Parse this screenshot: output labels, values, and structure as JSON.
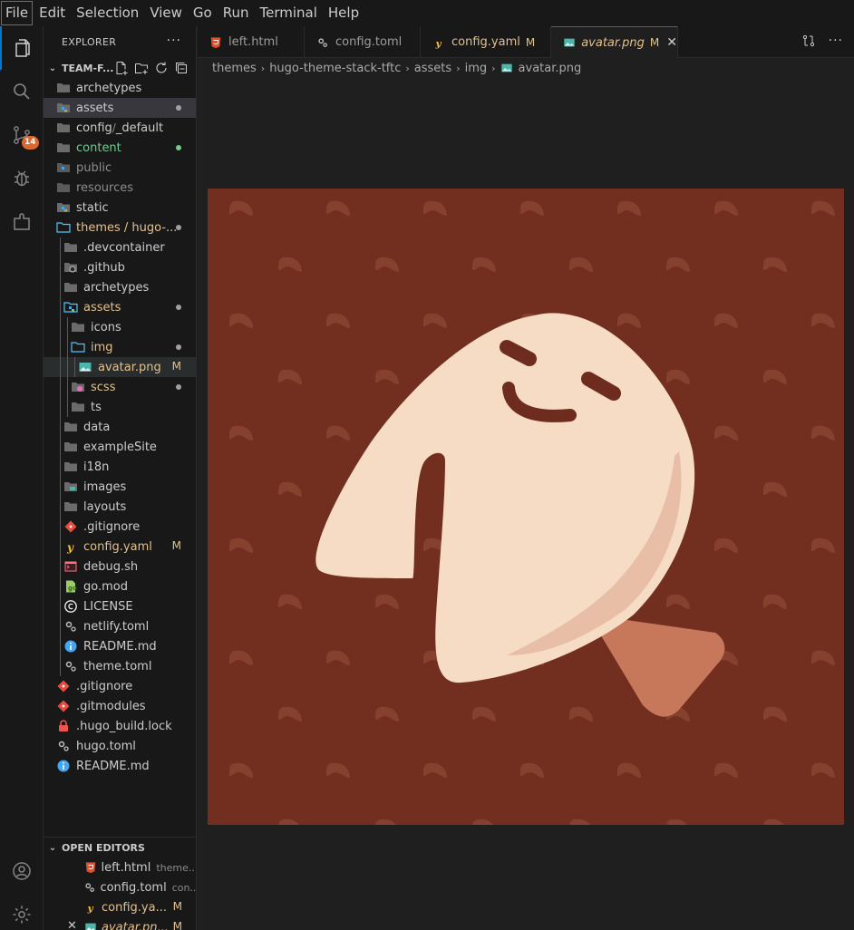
{
  "menu": [
    "File",
    "Edit",
    "Selection",
    "View",
    "Go",
    "Run",
    "Terminal",
    "Help"
  ],
  "activity": {
    "scm_badge": "14"
  },
  "explorer": {
    "title": "EXPLORER",
    "root": "TEAM-F...",
    "items": [
      {
        "label": "archetypes"
      },
      {
        "label": "assets"
      },
      {
        "label": "config",
        "sub": "_default"
      },
      {
        "label": "content"
      },
      {
        "label": "public"
      },
      {
        "label": "resources"
      },
      {
        "label": "static"
      },
      {
        "label": "themes / hugo-..."
      },
      {
        "label": ".devcontainer"
      },
      {
        "label": ".github"
      },
      {
        "label": "archetypes"
      },
      {
        "label": "assets"
      },
      {
        "label": "icons"
      },
      {
        "label": "img"
      },
      {
        "label": "avatar.png",
        "status": "M"
      },
      {
        "label": "scss"
      },
      {
        "label": "ts"
      },
      {
        "label": "data"
      },
      {
        "label": "exampleSite"
      },
      {
        "label": "i18n"
      },
      {
        "label": "images"
      },
      {
        "label": "layouts"
      },
      {
        "label": ".gitignore"
      },
      {
        "label": "config.yaml",
        "status": "M"
      },
      {
        "label": "debug.sh"
      },
      {
        "label": "go.mod"
      },
      {
        "label": "LICENSE"
      },
      {
        "label": "netlify.toml"
      },
      {
        "label": "README.md"
      },
      {
        "label": "theme.toml"
      },
      {
        "label": ".gitignore"
      },
      {
        "label": ".gitmodules"
      },
      {
        "label": ".hugo_build.lock"
      },
      {
        "label": "hugo.toml"
      },
      {
        "label": "README.md"
      }
    ],
    "config_sep": "/"
  },
  "open_editors": {
    "title": "OPEN EDITORS",
    "items": [
      {
        "label": "left.html",
        "desc": "theme..."
      },
      {
        "label": "config.toml",
        "desc": "con..."
      },
      {
        "label": "config.ya...",
        "status": "M"
      },
      {
        "label": "avatar.pn...",
        "status": "M"
      }
    ]
  },
  "tabs": [
    {
      "label": "left.html"
    },
    {
      "label": "config.toml"
    },
    {
      "label": "config.yaml",
      "status": "M"
    },
    {
      "label": "avatar.png",
      "status": "M"
    }
  ],
  "breadcrumb": [
    "themes",
    "hugo-theme-stack-tftc",
    "assets",
    "img",
    "avatar.png"
  ],
  "colors": {
    "accent": "#0078d4",
    "modified": "#e2c08d",
    "untracked": "#73c991",
    "image_bg": "#722f20",
    "image_pattern": "#86402e",
    "cookie": "#f6dcc4",
    "cookie_shade": "#e8bfa6",
    "paper": "#c7775a",
    "face": "#6e2c1e"
  }
}
